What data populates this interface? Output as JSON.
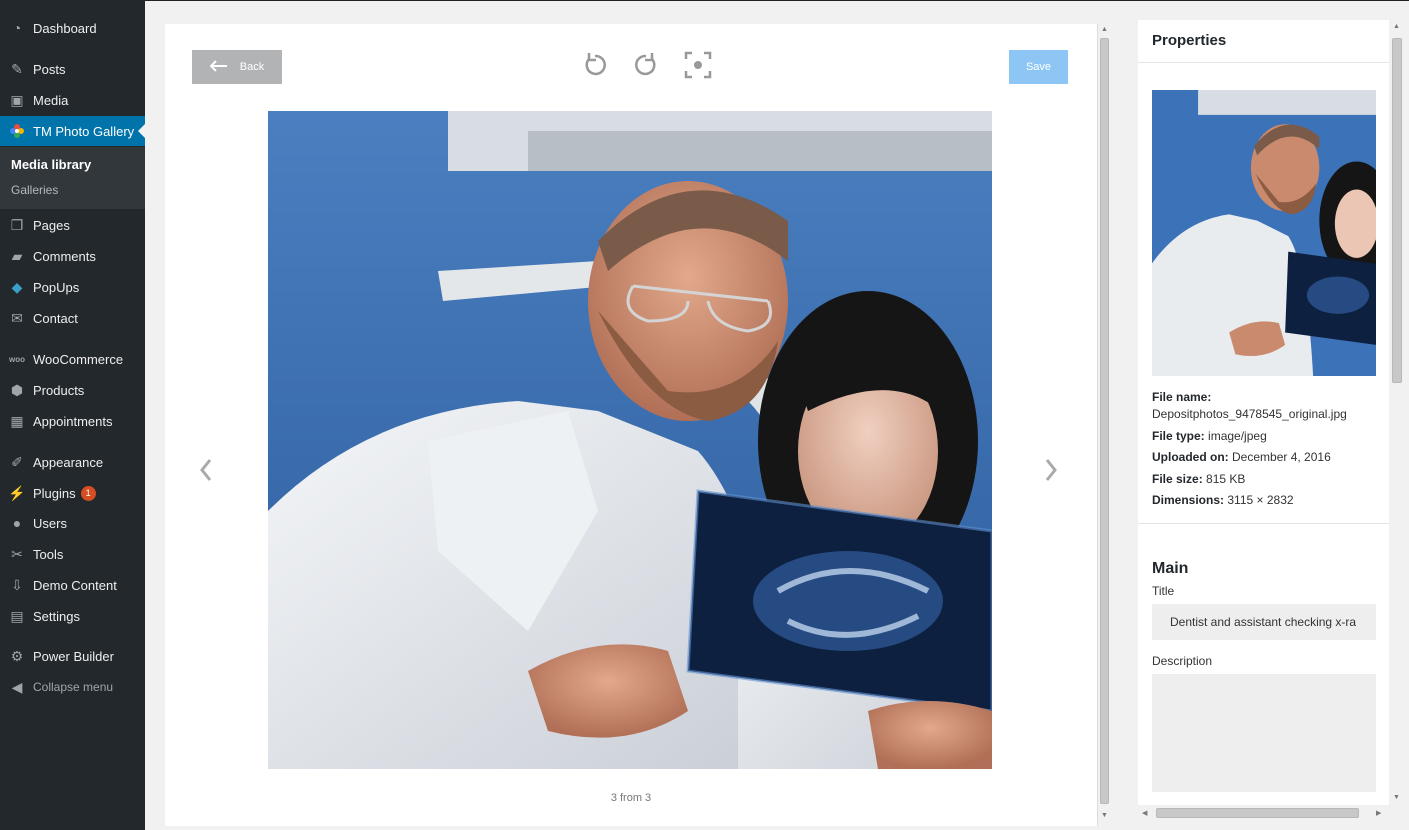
{
  "sidebar": {
    "items": [
      {
        "label": "Dashboard",
        "icon": "dashboard-icon"
      },
      {
        "label": "Posts",
        "icon": "pin-icon"
      },
      {
        "label": "Media",
        "icon": "media-icon"
      },
      {
        "label": "TM Photo Gallery",
        "icon": "flower-icon",
        "active": true
      },
      {
        "label": "Pages",
        "icon": "pages-icon"
      },
      {
        "label": "Comments",
        "icon": "comment-icon"
      },
      {
        "label": "PopUps",
        "icon": "popups-icon"
      },
      {
        "label": "Contact",
        "icon": "mail-icon"
      },
      {
        "label": "WooCommerce",
        "icon": "woo-icon"
      },
      {
        "label": "Products",
        "icon": "box-icon"
      },
      {
        "label": "Appointments",
        "icon": "calendar-icon"
      },
      {
        "label": "Appearance",
        "icon": "brush-icon"
      },
      {
        "label": "Plugins",
        "icon": "plug-icon",
        "badge": "1"
      },
      {
        "label": "Users",
        "icon": "user-icon"
      },
      {
        "label": "Tools",
        "icon": "wrench-icon"
      },
      {
        "label": "Demo Content",
        "icon": "download-icon"
      },
      {
        "label": "Settings",
        "icon": "settings-icon"
      },
      {
        "label": "Power Builder",
        "icon": "gear-icon"
      }
    ],
    "submenu": [
      "Media library",
      "Galleries"
    ],
    "collapse_label": "Collapse menu"
  },
  "editor": {
    "back_label": "Back",
    "save_label": "Save",
    "counter": "3 from 3",
    "tools": [
      "rotate-left-icon",
      "rotate-right-icon",
      "focus-crop-icon"
    ]
  },
  "properties": {
    "heading": "Properties",
    "file_name_label": "File name:",
    "file_name": "Depositphotos_9478545_original.jpg",
    "file_type_label": "File type:",
    "file_type": "image/jpeg",
    "uploaded_label": "Uploaded on:",
    "uploaded": "December 4, 2016",
    "size_label": "File size:",
    "size": "815 KB",
    "dimensions_label": "Dimensions:",
    "dimensions": "3115 × 2832",
    "section_main": "Main",
    "title_label": "Title",
    "title_value": "Dentist and assistant checking x-ra",
    "description_label": "Description",
    "description_value": ""
  },
  "colors": {
    "accent": "#0073aa",
    "sidebar": "#23282d",
    "save": "#8dc6f4",
    "badge": "#d54e21"
  }
}
